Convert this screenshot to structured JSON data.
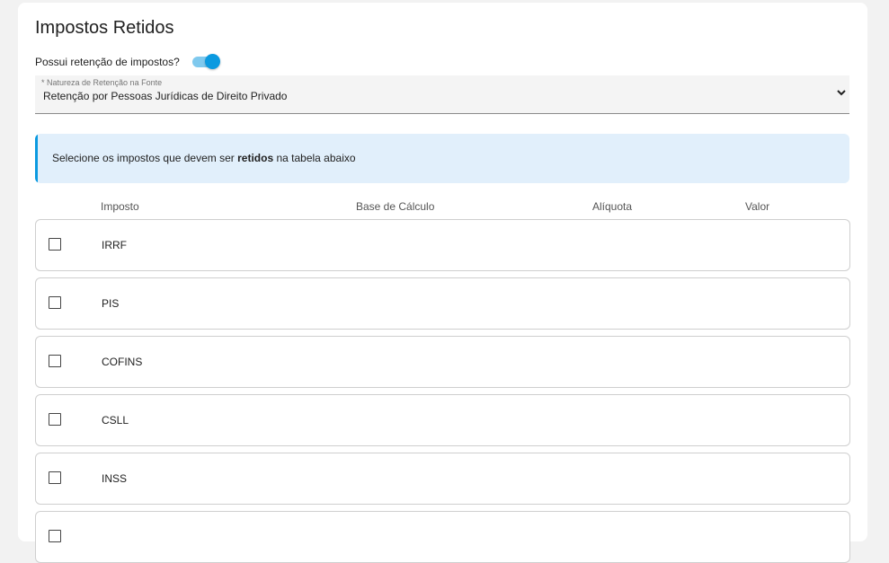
{
  "section": {
    "title": "Impostos Retidos"
  },
  "retention_toggle": {
    "label": "Possui retenção de impostos?",
    "checked": true
  },
  "nature_select": {
    "label": "* Natureza de Retenção na Fonte",
    "value": "Retenção por Pessoas Jurídicas de Direito Privado"
  },
  "info_banner": {
    "prefix": "Selecione os impostos que devem ser ",
    "emphasis": "retidos",
    "suffix": " na tabela abaixo"
  },
  "table": {
    "headers": {
      "imposto": "Imposto",
      "base": "Base de Cálculo",
      "aliquota": "Alíquota",
      "valor": "Valor"
    },
    "rows": [
      {
        "name": "IRRF",
        "checked": false
      },
      {
        "name": "PIS",
        "checked": false
      },
      {
        "name": "COFINS",
        "checked": false
      },
      {
        "name": "CSLL",
        "checked": false
      },
      {
        "name": "INSS",
        "checked": false
      },
      {
        "name": "",
        "checked": false
      }
    ]
  },
  "colors": {
    "accent": "#0b9ae0",
    "toggle_track": "#7fc9ee",
    "info_background": "#e1effb",
    "page_background": "#f2f2f2"
  }
}
